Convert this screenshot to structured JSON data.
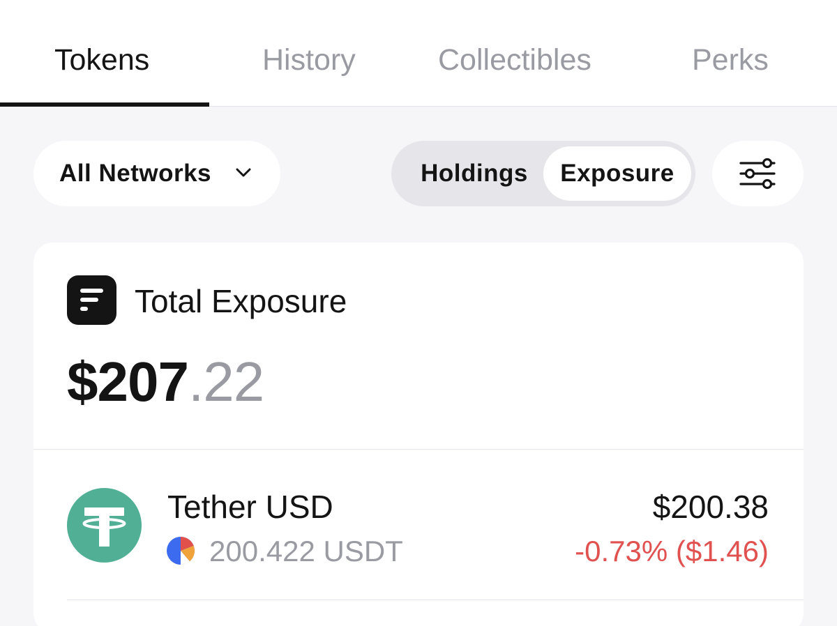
{
  "tabs": {
    "tokens": "Tokens",
    "history": "History",
    "collectibles": "Collectibles",
    "perks": "Perks",
    "active": "Tokens"
  },
  "controls": {
    "network_label": "All Networks",
    "segment_holdings": "Holdings",
    "segment_exposure": "Exposure",
    "selected_segment": "Exposure",
    "filter_icon": "sliders-icon",
    "dropdown_icon": "chevron-down-icon"
  },
  "summary": {
    "title": "Total Exposure",
    "amount_whole": "$207",
    "amount_decimal": ".22",
    "icon": "exposure-lines-icon"
  },
  "tokens": [
    {
      "name": "Tether USD",
      "balance": "200.422 USDT",
      "value": "$200.38",
      "change": "-0.73% ($1.46)",
      "logo_icon": "tether-logo-icon",
      "chain_icon": "pie-chart-icon"
    }
  ],
  "colors": {
    "background": "#f6f6f9",
    "surface": "#ffffff",
    "text_primary": "#141414",
    "text_secondary": "#9a9ba2",
    "negative": "#e0514f",
    "tether_green": "#50af95"
  }
}
